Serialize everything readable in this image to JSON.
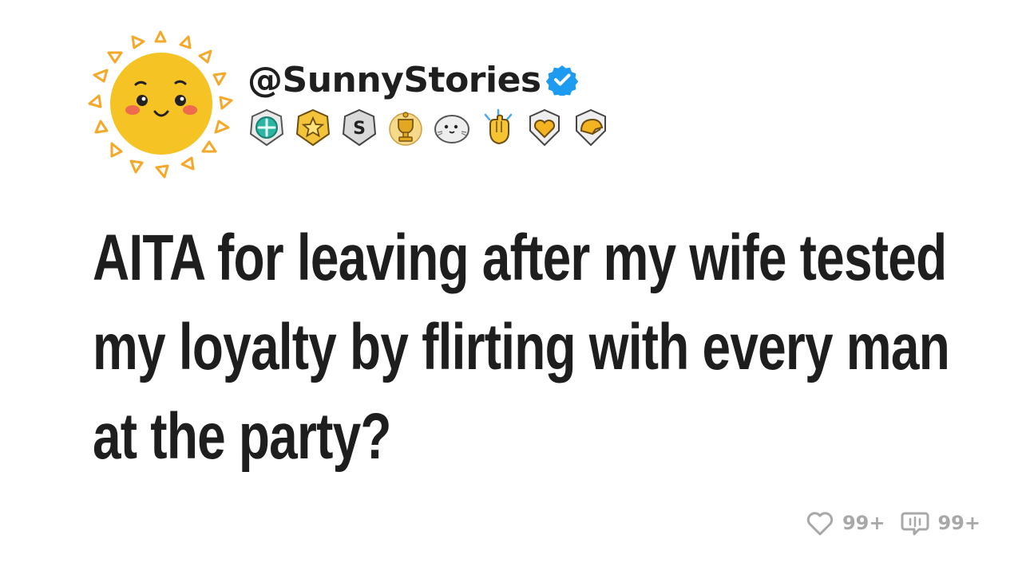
{
  "header": {
    "username": "@SunnyStories",
    "verified_icon": "verified-check-icon",
    "avatar_icon": "smiling-sun-icon"
  },
  "badges": [
    "teal-gem-award-icon",
    "gold-star-award-icon",
    "silver-s-award-icon",
    "gold-trophy-award-icon",
    "seal-award-icon",
    "clapping-hands-award-icon",
    "gold-heart-award-icon",
    "helmet-award-icon"
  ],
  "post": {
    "title": "AITA for leaving after my wife tested my loyalty by flirting with every man at the party?"
  },
  "stats": {
    "likes_label": "99+",
    "comments_label": "99+"
  },
  "colors": {
    "text": "#1e1e1e",
    "verified_blue": "#1d9bf0",
    "sun_yellow": "#f6c324",
    "sun_ray_orange": "#f4a92a",
    "stats_gray": "#a8a8a8"
  }
}
